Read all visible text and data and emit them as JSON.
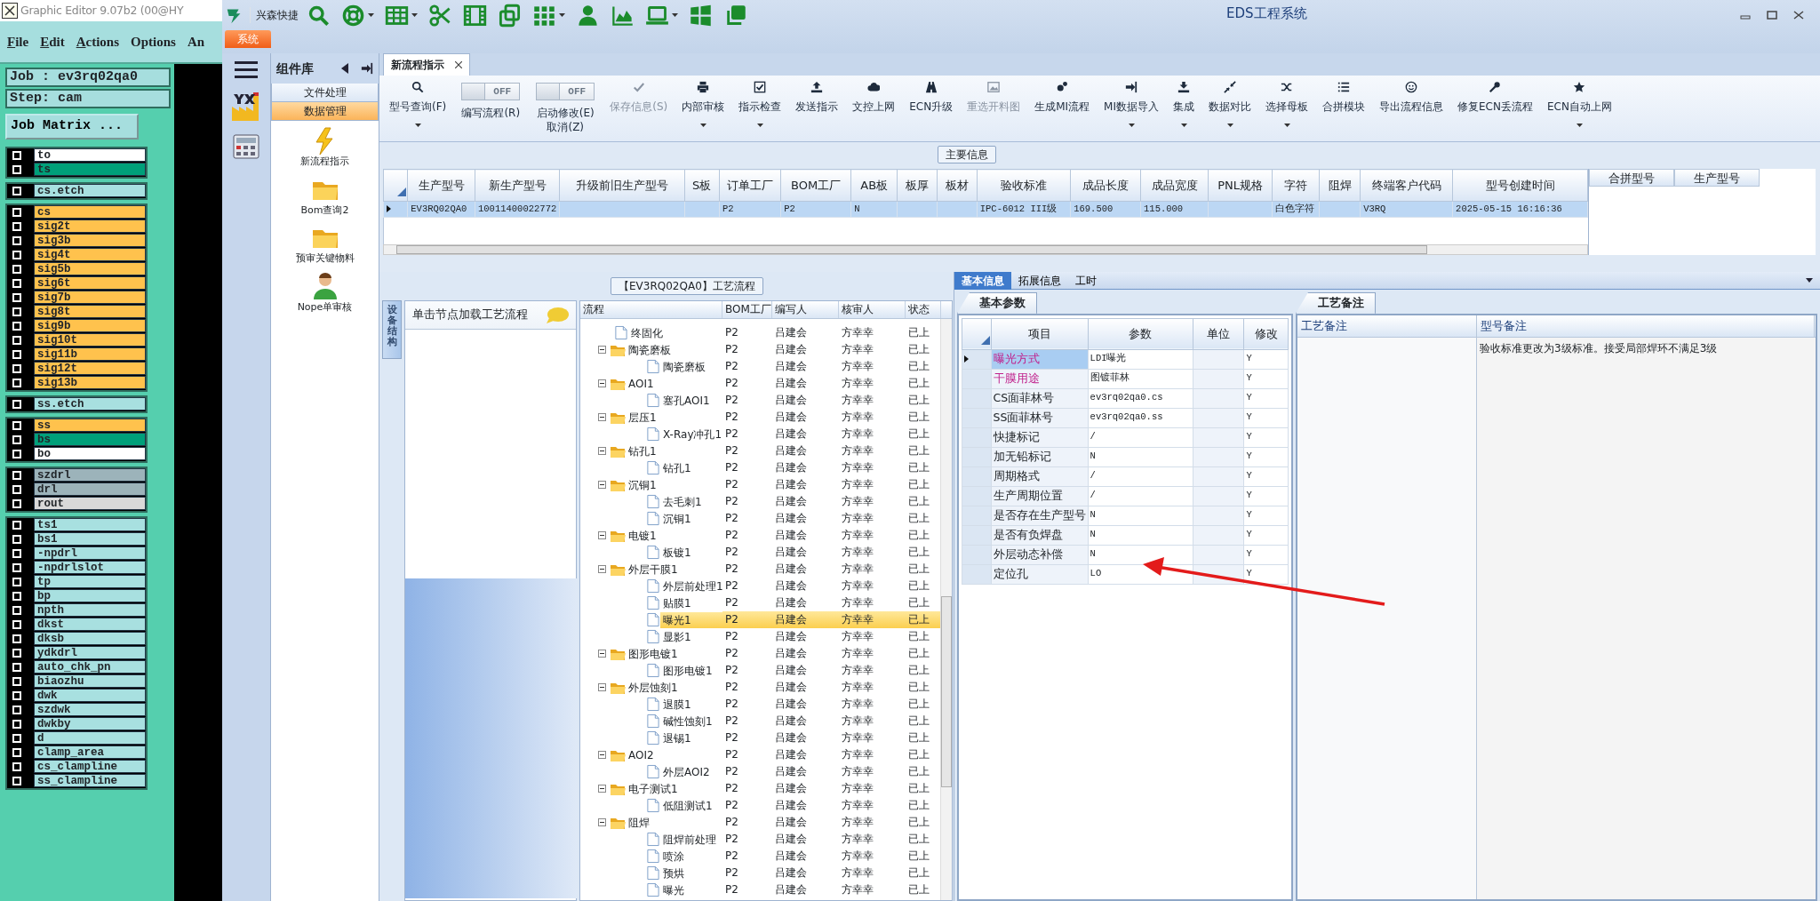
{
  "graphic_editor": {
    "title": "Graphic Editor 9.07b2 (00@HY",
    "menu": [
      {
        "label": "File",
        "mnemonic": true
      },
      {
        "label": "Edit",
        "mnemonic": true
      },
      {
        "label": "Actions",
        "mnemonic": true
      },
      {
        "label": "Options",
        "mnemonic": false
      },
      {
        "label": "An",
        "mnemonic": false
      }
    ],
    "job": "Job : ev3rq02qa0",
    "step": "Step: cam",
    "matrix_button": "Job Matrix ...",
    "layer_groups": [
      [
        {
          "name": "to",
          "color": "#ffffff",
          "checked": false
        },
        {
          "name": "ts",
          "color": "#00a07a",
          "checked": false
        }
      ],
      [
        {
          "name": "cs.etch",
          "color": "#a8e0e0",
          "checked": false
        }
      ],
      [
        {
          "name": "cs",
          "color": "#ffc24d",
          "checked": false
        },
        {
          "name": "sig2t",
          "color": "#ffc24d",
          "checked": false
        },
        {
          "name": "sig3b",
          "color": "#ffc24d",
          "checked": false
        },
        {
          "name": "sig4t",
          "color": "#ffc24d",
          "checked": false
        },
        {
          "name": "sig5b",
          "color": "#ffc24d",
          "checked": false
        },
        {
          "name": "sig6t",
          "color": "#ffc24d",
          "checked": false
        },
        {
          "name": "sig7b",
          "color": "#ffc24d",
          "checked": false
        },
        {
          "name": "sig8t",
          "color": "#ffc24d",
          "checked": false
        },
        {
          "name": "sig9b",
          "color": "#ffc24d",
          "checked": false
        },
        {
          "name": "sig10t",
          "color": "#ffc24d",
          "checked": false
        },
        {
          "name": "sig11b",
          "color": "#ffc24d",
          "checked": false
        },
        {
          "name": "sig12t",
          "color": "#ffc24d",
          "checked": false
        },
        {
          "name": "sig13b",
          "color": "#ffc24d",
          "checked": false
        }
      ],
      [
        {
          "name": "ss.etch",
          "color": "#a8e0e0",
          "checked": false
        }
      ],
      [
        {
          "name": "ss",
          "color": "#ffc24d",
          "checked": false
        },
        {
          "name": "bs",
          "color": "#00a07a",
          "checked": false
        },
        {
          "name": "bo",
          "color": "#ffffff",
          "checked": false
        }
      ],
      [
        {
          "name": "szdrl",
          "color": "#9cb3ba",
          "checked": false
        },
        {
          "name": "drl",
          "color": "#9cb3ba",
          "checked": false
        },
        {
          "name": "rout",
          "color": "#d9d9d9",
          "checked": false
        }
      ],
      [
        {
          "name": "ts1",
          "color": "#a8e0e0",
          "checked": false
        },
        {
          "name": "bs1",
          "color": "#a8e0e0",
          "checked": false
        },
        {
          "name": "-npdrl",
          "color": "#a8e0e0",
          "checked": false
        },
        {
          "name": "-npdrlslot",
          "color": "#a8e0e0",
          "checked": false
        },
        {
          "name": "tp",
          "color": "#a8e0e0",
          "checked": false
        },
        {
          "name": "bp",
          "color": "#a8e0e0",
          "checked": false
        },
        {
          "name": "npth",
          "color": "#a8e0e0",
          "checked": false
        },
        {
          "name": "dkst",
          "color": "#a8e0e0",
          "checked": false
        },
        {
          "name": "dksb",
          "color": "#a8e0e0",
          "checked": false
        },
        {
          "name": "ydkdrl",
          "color": "#a8e0e0",
          "checked": false
        },
        {
          "name": "auto_chk_pn",
          "color": "#a8e0e0",
          "checked": false
        },
        {
          "name": "biaozhu",
          "color": "#a8e0e0",
          "checked": false
        },
        {
          "name": "dwk",
          "color": "#a8e0e0",
          "checked": false
        },
        {
          "name": "szdwk",
          "color": "#a8e0e0",
          "checked": false
        },
        {
          "name": "dwkby",
          "color": "#a8e0e0",
          "checked": false
        },
        {
          "name": "d",
          "color": "#a8e0e0",
          "checked": false
        },
        {
          "name": "clamp_area",
          "color": "#a8e0e0",
          "checked": false
        },
        {
          "name": "cs_clampline",
          "color": "#a8e0e0",
          "checked": false
        },
        {
          "name": "ss_clampline",
          "color": "#a8e0e0",
          "checked": false
        }
      ]
    ]
  },
  "eds": {
    "window_title": "EDS工程系统",
    "brand": "兴森快捷",
    "system_tab": {
      "label": "系统",
      "selected": true
    },
    "components": {
      "title": "组件库",
      "categories": [
        {
          "label": "文件处理",
          "selected": false
        },
        {
          "label": "数据管理",
          "selected": true
        }
      ],
      "items": [
        "新流程指示",
        "Bom查询2",
        "预审关键物料",
        "Nope单审核"
      ]
    },
    "doc_tabs": [
      {
        "label": "新流程指示",
        "selected": true
      }
    ],
    "ribbon": [
      {
        "kind": "button",
        "label": "型号查询(F)",
        "dropdown": true,
        "disabled": false
      },
      {
        "kind": "toggle",
        "switch_text": "OFF",
        "on": false,
        "label": "编写流程(R)"
      },
      {
        "kind": "toggle",
        "switch_text": "OFF",
        "on": false,
        "label": "启动修改(E)",
        "label_line2": "取消(Z)"
      },
      {
        "kind": "button",
        "label": "保存信息(S)",
        "dropdown": false,
        "disabled": true
      },
      {
        "kind": "button",
        "label": "内部审核",
        "dropdown": true,
        "disabled": false
      },
      {
        "kind": "button",
        "label": "指示检查",
        "dropdown": true,
        "disabled": false
      },
      {
        "kind": "button",
        "label": "发送指示",
        "dropdown": false,
        "disabled": false
      },
      {
        "kind": "button",
        "label": "文控上网",
        "dropdown": false,
        "disabled": false
      },
      {
        "kind": "button",
        "label": "ECN升级",
        "dropdown": false,
        "disabled": false
      },
      {
        "kind": "button",
        "label": "重选开料图",
        "dropdown": false,
        "disabled": true
      },
      {
        "kind": "button",
        "label": "生成MI流程",
        "dropdown": false,
        "disabled": false
      },
      {
        "kind": "button",
        "label": "MI数据导入",
        "dropdown": true,
        "disabled": false
      },
      {
        "kind": "button",
        "label": "集成",
        "dropdown": true,
        "disabled": false
      },
      {
        "kind": "button",
        "label": "数据对比",
        "dropdown": true,
        "disabled": false
      },
      {
        "kind": "button",
        "label": "选择母板",
        "dropdown": true,
        "disabled": false
      },
      {
        "kind": "button",
        "label": "合拼模块",
        "dropdown": false,
        "disabled": false
      },
      {
        "kind": "button",
        "label": "导出流程信息",
        "dropdown": false,
        "disabled": false
      },
      {
        "kind": "button",
        "label": "修复ECN丢流程",
        "dropdown": false,
        "disabled": false
      },
      {
        "kind": "button",
        "label": "ECN自动上网",
        "dropdown": true,
        "disabled": false
      }
    ],
    "main_info": {
      "title": "主要信息",
      "columns": [
        "生产型号",
        "新生产型号",
        "升级前旧生产型号",
        "S板",
        "订单工厂",
        "BOM工厂",
        "AB板",
        "板厚",
        "板材",
        "验收标准",
        "成品长度",
        "成品宽度",
        "PNL规格",
        "字符",
        "阻焊",
        "终端客户代码",
        "型号创建时间"
      ],
      "rows": [
        {
          "selected": true,
          "cells": [
            "EV3RQ02QA0",
            "10011400022772",
            null,
            null,
            "P2",
            "P2",
            "N",
            null,
            null,
            "IPC-6012 III级",
            "169.500",
            "115.000",
            null,
            "白色字符",
            null,
            "V3RQ",
            "2025-05-15 16:16:36"
          ]
        }
      ],
      "merge_columns": [
        "合拼型号",
        "生产型号"
      ]
    },
    "process": {
      "title": "【EV3RQ02QA0】工艺流程",
      "side_tab": "设备结构",
      "hint": "单击节点加载工艺流程",
      "columns": [
        "流程",
        "BOM工厂",
        "编写人",
        "核审人",
        "状态"
      ],
      "tree": [
        {
          "label": "终固化",
          "kind": "file",
          "bom": "P2",
          "writer": "吕建会",
          "reviewer": "方幸幸",
          "status": "已上",
          "selected": false
        },
        {
          "label": "陶瓷磨板",
          "kind": "folder",
          "expanded": true,
          "bom": "P2",
          "writer": "吕建会",
          "reviewer": "方幸幸",
          "status": "已上",
          "selected": false,
          "children": [
            {
              "label": "陶瓷磨板",
              "kind": "file",
              "bom": "P2",
              "writer": "吕建会",
              "reviewer": "方幸幸",
              "status": "已上",
              "selected": false
            }
          ]
        },
        {
          "label": "AOI1",
          "kind": "folder",
          "expanded": true,
          "bom": "P2",
          "writer": "吕建会",
          "reviewer": "方幸幸",
          "status": "已上",
          "selected": false,
          "children": [
            {
              "label": "塞孔AOI1",
              "kind": "file",
              "bom": "P2",
              "writer": "吕建会",
              "reviewer": "方幸幸",
              "status": "已上",
              "selected": false
            }
          ]
        },
        {
          "label": "层压1",
          "kind": "folder",
          "expanded": true,
          "bom": "P2",
          "writer": "吕建会",
          "reviewer": "方幸幸",
          "status": "已上",
          "selected": false,
          "children": [
            {
              "label": "X-Ray冲孔1",
              "kind": "file",
              "bom": "P2",
              "writer": "吕建会",
              "reviewer": "方幸幸",
              "status": "已上",
              "selected": false
            }
          ]
        },
        {
          "label": "钻孔1",
          "kind": "folder",
          "expanded": true,
          "bom": "P2",
          "writer": "吕建会",
          "reviewer": "方幸幸",
          "status": "已上",
          "selected": false,
          "children": [
            {
              "label": "钻孔1",
              "kind": "file",
              "bom": "P2",
              "writer": "吕建会",
              "reviewer": "方幸幸",
              "status": "已上",
              "selected": false
            }
          ]
        },
        {
          "label": "沉铜1",
          "kind": "folder",
          "expanded": true,
          "bom": "P2",
          "writer": "吕建会",
          "reviewer": "方幸幸",
          "status": "已上",
          "selected": false,
          "children": [
            {
              "label": "去毛刺1",
              "kind": "file",
              "bom": "P2",
              "writer": "吕建会",
              "reviewer": "方幸幸",
              "status": "已上",
              "selected": false
            },
            {
              "label": "沉铜1",
              "kind": "file",
              "bom": "P2",
              "writer": "吕建会",
              "reviewer": "方幸幸",
              "status": "已上",
              "selected": false
            }
          ]
        },
        {
          "label": "电镀1",
          "kind": "folder",
          "expanded": true,
          "bom": "P2",
          "writer": "吕建会",
          "reviewer": "方幸幸",
          "status": "已上",
          "selected": false,
          "children": [
            {
              "label": "板镀1",
              "kind": "file",
              "bom": "P2",
              "writer": "吕建会",
              "reviewer": "方幸幸",
              "status": "已上",
              "selected": false
            }
          ]
        },
        {
          "label": "外层干膜1",
          "kind": "folder",
          "expanded": true,
          "bom": "P2",
          "writer": "吕建会",
          "reviewer": "方幸幸",
          "status": "已上",
          "selected": false,
          "children": [
            {
              "label": "外层前处理1",
              "kind": "file",
              "bom": "P2",
              "writer": "吕建会",
              "reviewer": "方幸幸",
              "status": "已上",
              "selected": false
            },
            {
              "label": "贴膜1",
              "kind": "file",
              "bom": "P2",
              "writer": "吕建会",
              "reviewer": "方幸幸",
              "status": "已上",
              "selected": false
            },
            {
              "label": "曝光1",
              "kind": "file",
              "bom": "P2",
              "writer": "吕建会",
              "reviewer": "方幸幸",
              "status": "已上",
              "selected": true
            },
            {
              "label": "显影1",
              "kind": "file",
              "bom": "P2",
              "writer": "吕建会",
              "reviewer": "方幸幸",
              "status": "已上",
              "selected": false
            }
          ]
        },
        {
          "label": "图形电镀1",
          "kind": "folder",
          "expanded": true,
          "bom": "P2",
          "writer": "吕建会",
          "reviewer": "方幸幸",
          "status": "已上",
          "selected": false,
          "children": [
            {
              "label": "图形电镀1",
              "kind": "file",
              "bom": "P2",
              "writer": "吕建会",
              "reviewer": "方幸幸",
              "status": "已上",
              "selected": false
            }
          ]
        },
        {
          "label": "外层蚀刻1",
          "kind": "folder",
          "expanded": true,
          "bom": "P2",
          "writer": "吕建会",
          "reviewer": "方幸幸",
          "status": "已上",
          "selected": false,
          "children": [
            {
              "label": "退膜1",
              "kind": "file",
              "bom": "P2",
              "writer": "吕建会",
              "reviewer": "方幸幸",
              "status": "已上",
              "selected": false
            },
            {
              "label": "碱性蚀刻1",
              "kind": "file",
              "bom": "P2",
              "writer": "吕建会",
              "reviewer": "方幸幸",
              "status": "已上",
              "selected": false
            },
            {
              "label": "退锡1",
              "kind": "file",
              "bom": "P2",
              "writer": "吕建会",
              "reviewer": "方幸幸",
              "status": "已上",
              "selected": false
            }
          ]
        },
        {
          "label": "AOI2",
          "kind": "folder",
          "expanded": true,
          "bom": "P2",
          "writer": "吕建会",
          "reviewer": "方幸幸",
          "status": "已上",
          "selected": false,
          "children": [
            {
              "label": "外层AOI2",
              "kind": "file",
              "bom": "P2",
              "writer": "吕建会",
              "reviewer": "方幸幸",
              "status": "已上",
              "selected": false
            }
          ]
        },
        {
          "label": "电子测试1",
          "kind": "folder",
          "expanded": true,
          "bom": "P2",
          "writer": "吕建会",
          "reviewer": "方幸幸",
          "status": "已上",
          "selected": false,
          "children": [
            {
              "label": "低阻测试1",
              "kind": "file",
              "bom": "P2",
              "writer": "吕建会",
              "reviewer": "方幸幸",
              "status": "已上",
              "selected": false
            }
          ]
        },
        {
          "label": "阻焊",
          "kind": "folder",
          "expanded": true,
          "bom": "P2",
          "writer": "吕建会",
          "reviewer": "方幸幸",
          "status": "已上",
          "selected": false,
          "children": [
            {
              "label": "阻焊前处理",
              "kind": "file",
              "bom": "P2",
              "writer": "吕建会",
              "reviewer": "方幸幸",
              "status": "已上",
              "selected": false
            },
            {
              "label": "喷涂",
              "kind": "file",
              "bom": "P2",
              "writer": "吕建会",
              "reviewer": "方幸幸",
              "status": "已上",
              "selected": false
            },
            {
              "label": "预烘",
              "kind": "file",
              "bom": "P2",
              "writer": "吕建会",
              "reviewer": "方幸幸",
              "status": "已上",
              "selected": false
            },
            {
              "label": "曝光",
              "kind": "file",
              "bom": "P2",
              "writer": "吕建会",
              "reviewer": "方幸幸",
              "status": "已上",
              "selected": false
            }
          ]
        }
      ]
    },
    "detail_tabs": [
      {
        "label": "基本信息",
        "selected": true
      },
      {
        "label": "拓展信息",
        "selected": false
      },
      {
        "label": "工时",
        "selected": false
      }
    ],
    "params": {
      "tab": "基本参数",
      "columns": [
        "项目",
        "参数",
        "单位",
        "修改"
      ],
      "rows": [
        {
          "item": "曝光方式",
          "value": "LDI曝光",
          "modify": "Y",
          "emphasized": true,
          "selected": true
        },
        {
          "item": "干膜用途",
          "value": "图镀菲林",
          "modify": "Y",
          "emphasized": true,
          "selected": false
        },
        {
          "item": "CS面菲林号",
          "value": "ev3rq02qa0.cs",
          "modify": "Y",
          "emphasized": false,
          "selected": false
        },
        {
          "item": "SS面菲林号",
          "value": "ev3rq02qa0.ss",
          "modify": "Y",
          "emphasized": false,
          "selected": false
        },
        {
          "item": "快捷标记",
          "value": "/",
          "modify": "Y",
          "emphasized": false,
          "selected": false
        },
        {
          "item": "加无铅标记",
          "value": "N",
          "modify": "Y",
          "emphasized": false,
          "selected": false
        },
        {
          "item": "周期格式",
          "value": "/",
          "modify": "Y",
          "emphasized": false,
          "selected": false
        },
        {
          "item": "生产周期位置",
          "value": "/",
          "modify": "Y",
          "emphasized": false,
          "selected": false
        },
        {
          "item": "是否存在生产型号",
          "value": "N",
          "modify": "Y",
          "emphasized": false,
          "selected": false
        },
        {
          "item": "是否有负焊盘",
          "value": "N",
          "modify": "Y",
          "emphasized": false,
          "selected": false
        },
        {
          "item": "外层动态补偿",
          "value": "N",
          "modify": "Y",
          "emphasized": false,
          "selected": false
        },
        {
          "item": "定位孔",
          "value": "LO",
          "modify": "Y",
          "emphasized": false,
          "selected": false
        }
      ]
    },
    "remarks": {
      "tab": "工艺备注",
      "columns": [
        "工艺备注",
        "型号备注"
      ],
      "text": "验收标准更改为3级标准。接受局部焊环不满足3级"
    }
  }
}
